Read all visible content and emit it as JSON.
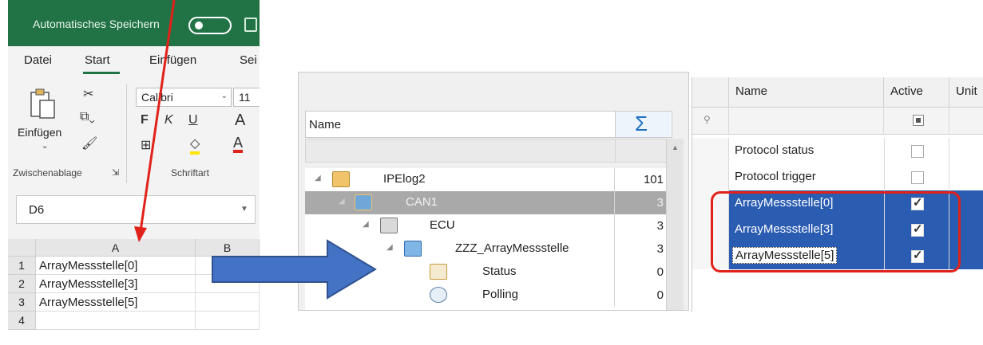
{
  "excel": {
    "titlebar": {
      "autosave_label": "Automatisches Speichern"
    },
    "menu": {
      "items": [
        "Datei",
        "Start",
        "Einfügen",
        "Sei"
      ]
    },
    "ribbon": {
      "paste_label": "Einfügen",
      "font_name": "Calibri",
      "font_size": "11",
      "clipboard_group": "Zwischenablage",
      "font_group": "Schriftart",
      "bold": "F",
      "italic": "K",
      "underline": "U"
    },
    "namebox": {
      "value": "D6"
    },
    "columns": [
      "A",
      "B"
    ],
    "rows": [
      {
        "num": "1",
        "a": "ArrayMessstelle[0]"
      },
      {
        "num": "2",
        "a": "ArrayMessstelle[3]"
      },
      {
        "num": "3",
        "a": "ArrayMessstelle[5]"
      },
      {
        "num": "4",
        "a": ""
      }
    ]
  },
  "tree": {
    "header_name": "Name",
    "sum_symbol": "Σ",
    "rows": [
      {
        "label": "IPElog2",
        "count": "101",
        "selected": false,
        "icon": "device-icon"
      },
      {
        "label": "CAN1",
        "count": "3",
        "selected": true,
        "icon": "can-bus-icon"
      },
      {
        "label": "ECU",
        "count": "3",
        "selected": false,
        "icon": "ecu-icon"
      },
      {
        "label": "ZZZ_ArrayMessstelle",
        "count": "3",
        "selected": false,
        "icon": "ccp-icon"
      },
      {
        "label": "Status",
        "count": "0",
        "selected": false,
        "icon": "status-icon"
      },
      {
        "label": "Polling",
        "count": "0",
        "selected": false,
        "icon": "polling-icon"
      }
    ]
  },
  "signals": {
    "columns": {
      "name": "Name",
      "active": "Active",
      "unit": "Unit"
    },
    "rows": [
      {
        "name": "Protocol status",
        "active": false
      },
      {
        "name": "Protocol trigger",
        "active": false
      },
      {
        "name": "ArrayMessstelle[0]",
        "active": true
      },
      {
        "name": "ArrayMessstelle[3]",
        "active": true
      },
      {
        "name": "ArrayMessstelle[5]",
        "active": true
      }
    ]
  },
  "colors": {
    "excel_green": "#217346",
    "selection_blue": "#2a5cb1",
    "annotation_red": "#e0221a",
    "arrow_blue": "#4472c4"
  }
}
